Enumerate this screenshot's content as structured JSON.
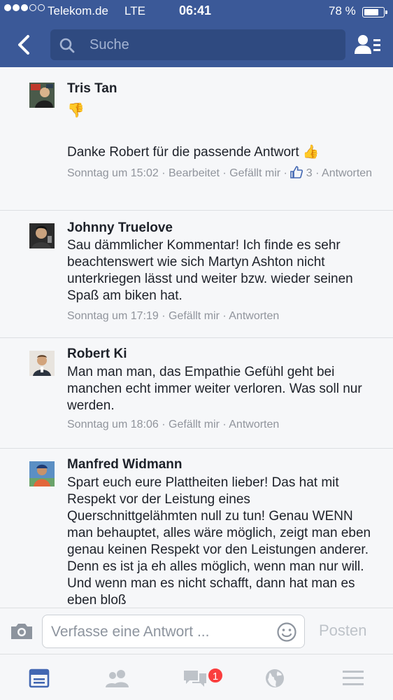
{
  "status_bar": {
    "carrier": "Telekom.de",
    "network": "LTE",
    "time": "06:41",
    "battery_percent": "78 %",
    "battery_level": 0.78,
    "signal_bars_filled": 3,
    "signal_bars_total": 5
  },
  "header": {
    "search_placeholder": "Suche",
    "icons": {
      "back": "chevron-left-icon",
      "search": "search-icon",
      "friends": "friend-list-icon"
    }
  },
  "comments": [
    {
      "author": "Tris Tan",
      "text_before": "👎",
      "text": "Danke Robert für die passende Antwort 👍",
      "time": "Sonntag um 15:02",
      "edited": "Bearbeitet",
      "like_label": "Gefällt mir",
      "like_count": "3",
      "reply_label": "Antworten"
    },
    {
      "author": "Johnny Truelove",
      "text": "Sau dämmlicher Kommentar! Ich finde es sehr beachtenswert wie sich Martyn Ashton nicht unterkriegen lässt und weiter bzw. wieder seinen Spaß am biken hat.",
      "time": "Sonntag um 17:19",
      "like_label": "Gefällt mir",
      "reply_label": "Antworten"
    },
    {
      "author": "Robert Ki",
      "text": "Man man man, das Empathie Gefühl geht bei manchen echt immer weiter verloren. Was soll nur werden.",
      "time": "Sonntag um 18:06",
      "like_label": "Gefällt mir",
      "reply_label": "Antworten"
    },
    {
      "author": "Manfred Widmann",
      "text": "Spart euch eure Plattheiten lieber! Das hat mit Respekt vor der Leistung eines Querschnittgelähmten null zu tun! Genau WENN man behauptet, alles wäre möglich, zeigt man eben genau keinen Respekt vor den Leistungen anderer. Denn es ist ja eh alles möglich, wenn man nur will. Und wenn man es nicht schafft, dann hat man es eben bloß"
    }
  ],
  "reply_bar": {
    "placeholder": "Verfasse eine Antwort ...",
    "post_label": "Posten"
  },
  "tab_bar": {
    "tabs": [
      "news-feed-icon",
      "friend-requests-icon",
      "messages-icon",
      "notifications-globe-icon",
      "menu-icon"
    ],
    "messages_badge": "1",
    "active_tab": 0
  },
  "colors": {
    "brand": "#3b5998",
    "search_bg": "#2f4a80",
    "meta_text": "#90949c",
    "like_blue": "#4267b2",
    "badge_red": "#fa3e3e",
    "tab_active": "#4267b2",
    "tab_inactive": "#bec3c9"
  }
}
